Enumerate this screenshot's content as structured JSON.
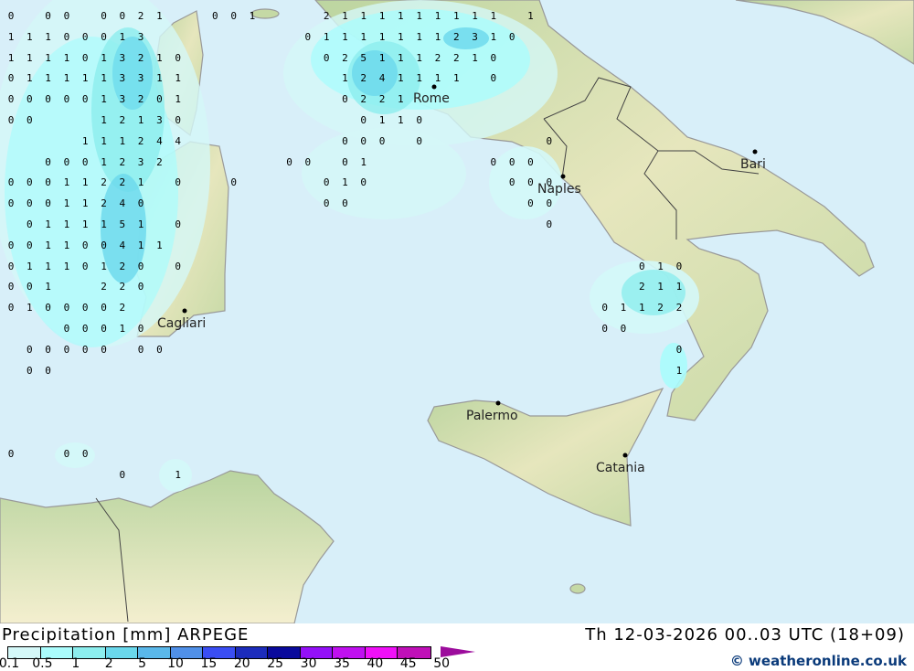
{
  "header": {
    "title": "Precipitation [mm] ARPEGE",
    "datetime": "Th 12-03-2026 00..03 UTC (18+09)",
    "credit": "© weatheronline.co.uk"
  },
  "legend": {
    "ticks": [
      "0.1",
      "0.5",
      "1",
      "2",
      "5",
      "10",
      "15",
      "20",
      "25",
      "30",
      "35",
      "40",
      "45",
      "50"
    ],
    "colors": [
      "#d4f8f8",
      "#aafcfc",
      "#8ceeee",
      "#6ad8ec",
      "#5ab8ea",
      "#5090e8",
      "#3a4ef4",
      "#1c2cbc",
      "#0a0a9c",
      "#9410f8",
      "#c010f0",
      "#f010f8",
      "#c010b8"
    ],
    "overflow_color": "#9c0c9c"
  },
  "cities": [
    {
      "name": "Rome"
    },
    {
      "name": "Naples"
    },
    {
      "name": "Bari"
    },
    {
      "name": "Palermo"
    },
    {
      "name": "Catania"
    },
    {
      "name": "Cagliari"
    }
  ],
  "precip_grid_rows": [
    "0 00 0021  001   2111111111 1",
    "11100013        011111112310",
    "1111013210       0251112210",
    "0111113311        1241111 0",
    "0000013201        0221",
    "00   12130         0110",
    "    111244        000 0      0",
    "  0001232      00 01      000",
    "00011221 0  0    010       000",
    "00011240         00         00",
    " 0111151 0                   0",
    "001100411",
    "01110120 0                        010",
    "001  220                          211",
    "0100002                         01122",
    "   00010                        00",
    " 00000 00                           0",
    " 00                                 1",
    "",
    "",
    "",
    "0  00",
    "      0  1"
  ],
  "colors": {
    "sea": "#d8eff9",
    "land": "#cfdcae",
    "land_high": "#efe9c6"
  }
}
